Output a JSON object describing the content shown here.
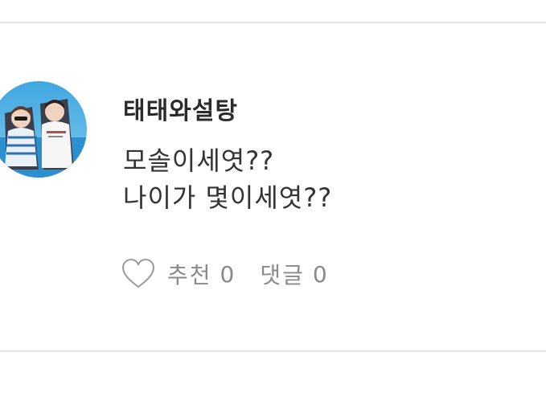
{
  "comment": {
    "username": "태태와설탕",
    "lines": [
      "모솔이세엿??",
      "나이가 몇이세엿??"
    ],
    "avatar_icon": "user-photo",
    "actions": {
      "like_icon": "heart-outline-icon",
      "recommend_label": "추천",
      "recommend_count": "0",
      "reply_label": "댓글",
      "reply_count": "0"
    }
  },
  "colors": {
    "divider": "#e6e6e6",
    "text": "#333333",
    "action_text": "#8a8a8a"
  }
}
